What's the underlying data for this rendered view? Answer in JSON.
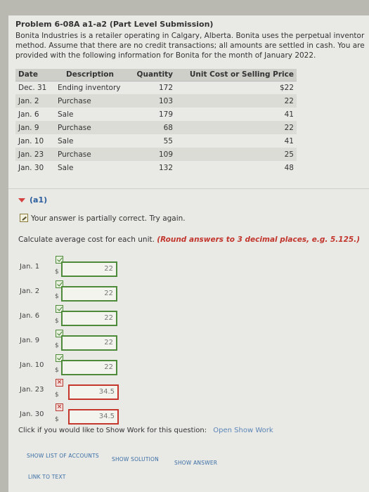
{
  "problem_title": "Problem 6-08A a1-a2 (Part Level Submission)",
  "intro_lines": [
    "Bonita Industries is a retailer operating in Calgary, Alberta. Bonita uses the perpetual inventor",
    "method. Assume that there are no credit transactions; all amounts are settled in cash. You are",
    "provided with the following information for Bonita for the month of January 2022."
  ],
  "table": {
    "headers": [
      "Date",
      "Description",
      "Quantity",
      "Unit Cost or Selling Price"
    ],
    "rows": [
      [
        "Dec. 31",
        "Ending inventory",
        "172",
        "$22"
      ],
      [
        "Jan. 2",
        "Purchase",
        "103",
        "22"
      ],
      [
        "Jan. 6",
        "Sale",
        "179",
        "41"
      ],
      [
        "Jan. 9",
        "Purchase",
        "68",
        "22"
      ],
      [
        "Jan. 10",
        "Sale",
        "55",
        "41"
      ],
      [
        "Jan. 23",
        "Purchase",
        "109",
        "25"
      ],
      [
        "Jan. 30",
        "Sale",
        "132",
        "48"
      ]
    ]
  },
  "section": {
    "label": "(a1)",
    "status": "Your answer is partially correct.  Try again.",
    "prompt": "Calculate average cost for each unit.",
    "hint": "(Round answers to 3 decimal places, e.g. 5.125.)"
  },
  "answers": [
    {
      "date": "Jan. 1",
      "currency": "$",
      "value": "22",
      "status": "correct"
    },
    {
      "date": "Jan. 2",
      "currency": "$",
      "value": "22",
      "status": "correct"
    },
    {
      "date": "Jan. 6",
      "currency": "$",
      "value": "22",
      "status": "correct"
    },
    {
      "date": "Jan. 9",
      "currency": "$",
      "value": "22",
      "status": "correct"
    },
    {
      "date": "Jan. 10",
      "currency": "$",
      "value": "22",
      "status": "correct"
    },
    {
      "date": "Jan. 23",
      "currency": "$",
      "value": "34.5",
      "status": "incorrect"
    },
    {
      "date": "Jan. 30",
      "currency": "$",
      "value": "34.5",
      "status": "incorrect"
    }
  ],
  "show_work": {
    "text": "Click if you would like to Show Work for this question:",
    "link": "Open Show Work"
  },
  "buttons": {
    "list_accounts": "SHOW LIST OF ACCOUNTS",
    "solution": "SHOW SOLUTION",
    "answer": "SHOW ANSWER",
    "link_text": "LINK TO TEXT"
  },
  "colors": {
    "correct": "#4d8a3a",
    "incorrect": "#c5362c",
    "hint": "#c2352c",
    "section": "#2b5e9e"
  }
}
